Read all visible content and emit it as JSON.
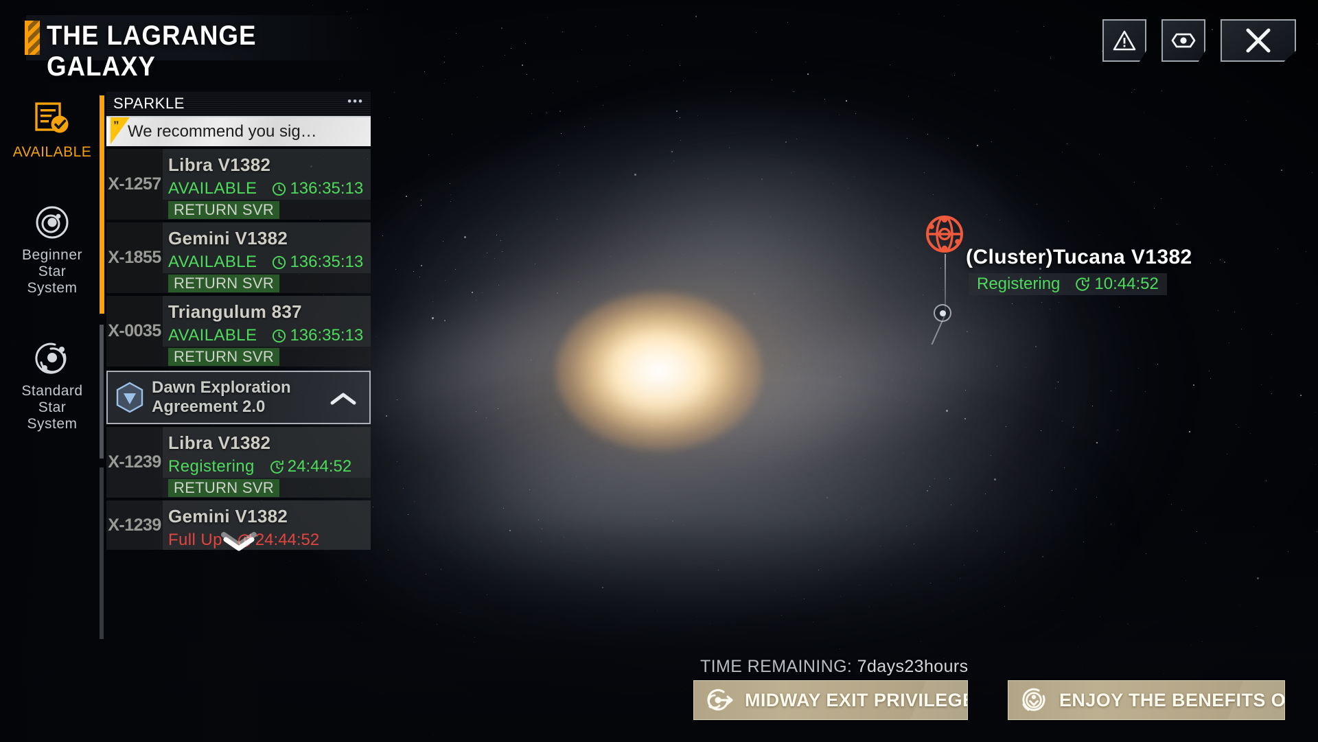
{
  "header": {
    "title": "THE LAGRANGE GALAXY"
  },
  "top_buttons": [
    {
      "name": "warning-button",
      "icon": "warning-triangle-icon"
    },
    {
      "name": "visibility-button",
      "icon": "eye-icon"
    },
    {
      "name": "close-button",
      "icon": "close-x-icon"
    }
  ],
  "sidebar": {
    "items": [
      {
        "label": "AVAILABLE",
        "icon": "checklist-icon",
        "active": true
      },
      {
        "label": "Beginner\nStar\nSystem",
        "icon": "orbit-icon",
        "active": false
      },
      {
        "label": "Standard\nStar\nSystem",
        "icon": "orbit-icon",
        "active": false
      }
    ]
  },
  "panel": {
    "group_title": "SPARKLE",
    "menu_dots": "•••",
    "recommendation": "We recommend you sig…",
    "servers": [
      {
        "id": "X-1257",
        "name": "Libra V1382",
        "status": "AVAILABLE",
        "status_color": "#4ddb5b",
        "timer": "136:35:13",
        "tag": "RETURN SVR"
      },
      {
        "id": "X-1855",
        "name": "Gemini V1382",
        "status": "AVAILABLE",
        "status_color": "#4ddb5b",
        "timer": "136:35:13",
        "tag": "RETURN SVR"
      },
      {
        "id": "X-0035",
        "name": "Triangulum 837",
        "status": "AVAILABLE",
        "status_color": "#4ddb5b",
        "timer": "136:35:13",
        "tag": "RETURN SVR"
      }
    ],
    "agreement": {
      "line1": "Dawn Exploration",
      "line2": "Agreement 2.0",
      "icon": "hexagon-triangle-icon",
      "chevron": "chevron-up-icon"
    },
    "agreement_servers": [
      {
        "id": "X-1239",
        "name": "Libra V1382",
        "status": "Registering",
        "status_color": "#4ddb5b",
        "timer": "24:44:52",
        "tag": "RETURN SVR"
      },
      {
        "id": "X-1239",
        "name": "Gemini V1382",
        "status": "Full Up",
        "status_color": "#e2453f",
        "timer": "24:44:52",
        "tag": ""
      }
    ],
    "scroll_down_icon": "chevron-down-icon"
  },
  "cluster_marker": {
    "icon": "cluster-node-icon",
    "name": "(Cluster)Tucana V1382",
    "status": "Registering",
    "timer": "10:44:52",
    "status_color": "#4ddb5b",
    "marker_color": "#f05a3c"
  },
  "bottom": {
    "time_remaining_label": "TIME REMAINING:",
    "time_remaining_value": "7days23hours",
    "buttons": [
      {
        "label": "MIDWAY EXIT PRIVILEGE",
        "icon": "exit-arrow-icon"
      },
      {
        "label": "ENJOY THE BENEFITS OF…",
        "icon": "download-refresh-icon"
      }
    ]
  },
  "colors": {
    "accent_orange": "#f6a20b",
    "status_green": "#4ddb5b",
    "status_red": "#e2453f",
    "gold_button": "#b5a788"
  }
}
